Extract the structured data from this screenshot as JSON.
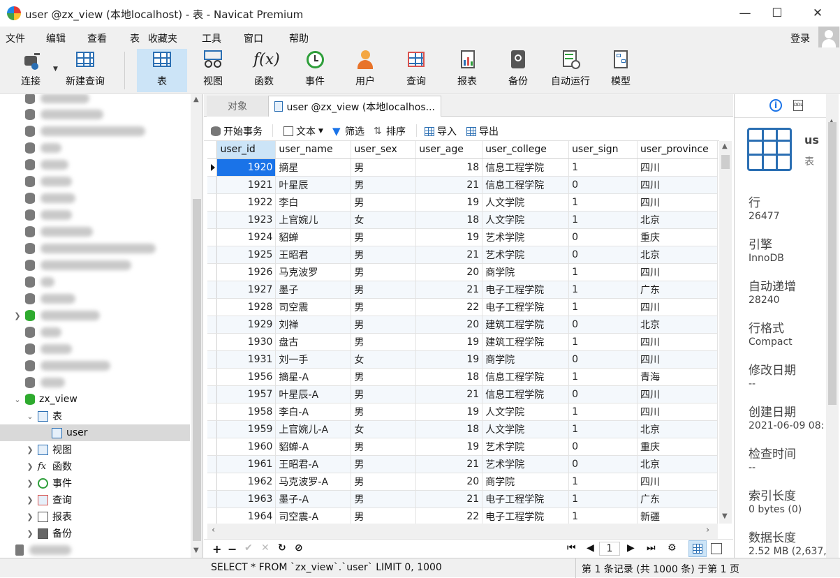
{
  "window": {
    "title": "user @zx_view (本地localhost) - 表 - Navicat Premium"
  },
  "menu": [
    "文件",
    "编辑",
    "查看",
    "表",
    "收藏夹",
    "工具",
    "窗口",
    "帮助"
  ],
  "login": "登录",
  "toolbar": {
    "connect": "连接",
    "new_query": "新建查询",
    "table": "表",
    "view": "视图",
    "function": "函数",
    "event": "事件",
    "user": "用户",
    "query": "查询",
    "report": "报表",
    "backup": "备份",
    "automation": "自动运行",
    "model": "模型"
  },
  "sidebar": {
    "db": "zx_view",
    "tables_group": "表",
    "table_user": "user",
    "view": "视图",
    "function": "函数",
    "event": "事件",
    "query": "查询",
    "report": "报表",
    "backup": "备份"
  },
  "tabs": {
    "objects": "对象",
    "active": "user @zx_view (本地localhos..."
  },
  "subtoolbar": {
    "begin_tx": "开始事务",
    "text": "文本",
    "filter": "筛选",
    "sort": "排序",
    "import": "导入",
    "export": "导出"
  },
  "columns": [
    "user_id",
    "user_name",
    "user_sex",
    "user_age",
    "user_college",
    "user_sign",
    "user_province"
  ],
  "rows": [
    [
      "1920",
      "摘星",
      "男",
      "18",
      "信息工程学院",
      "1",
      "四川"
    ],
    [
      "1921",
      "叶星辰",
      "男",
      "21",
      "信息工程学院",
      "0",
      "四川"
    ],
    [
      "1922",
      "李白",
      "男",
      "19",
      "人文学院",
      "1",
      "四川"
    ],
    [
      "1923",
      "上官婉儿",
      "女",
      "18",
      "人文学院",
      "1",
      "北京"
    ],
    [
      "1924",
      "貂蝉",
      "男",
      "19",
      "艺术学院",
      "0",
      "重庆"
    ],
    [
      "1925",
      "王昭君",
      "男",
      "21",
      "艺术学院",
      "0",
      "北京"
    ],
    [
      "1926",
      "马克波罗",
      "男",
      "20",
      "商学院",
      "1",
      "四川"
    ],
    [
      "1927",
      "墨子",
      "男",
      "21",
      "电子工程学院",
      "1",
      "广东"
    ],
    [
      "1928",
      "司空震",
      "男",
      "22",
      "电子工程学院",
      "1",
      "四川"
    ],
    [
      "1929",
      "刘禅",
      "男",
      "20",
      "建筑工程学院",
      "0",
      "北京"
    ],
    [
      "1930",
      "盘古",
      "男",
      "19",
      "建筑工程学院",
      "1",
      "四川"
    ],
    [
      "1931",
      "刘一手",
      "女",
      "19",
      "商学院",
      "0",
      "四川"
    ],
    [
      "1956",
      "摘星-A",
      "男",
      "18",
      "信息工程学院",
      "1",
      "青海"
    ],
    [
      "1957",
      "叶星辰-A",
      "男",
      "21",
      "信息工程学院",
      "0",
      "四川"
    ],
    [
      "1958",
      "李白-A",
      "男",
      "19",
      "人文学院",
      "1",
      "四川"
    ],
    [
      "1959",
      "上官婉儿-A",
      "女",
      "18",
      "人文学院",
      "1",
      "北京"
    ],
    [
      "1960",
      "貂蝉-A",
      "男",
      "19",
      "艺术学院",
      "0",
      "重庆"
    ],
    [
      "1961",
      "王昭君-A",
      "男",
      "21",
      "艺术学院",
      "0",
      "北京"
    ],
    [
      "1962",
      "马克波罗-A",
      "男",
      "20",
      "商学院",
      "1",
      "四川"
    ],
    [
      "1963",
      "墨子-A",
      "男",
      "21",
      "电子工程学院",
      "1",
      "广东"
    ],
    [
      "1964",
      "司空震-A",
      "男",
      "22",
      "电子工程学院",
      "1",
      "新疆"
    ]
  ],
  "navbar": {
    "page": "1"
  },
  "status": {
    "sql": "SELECT * FROM `zx_view`.`user` LIMIT 0, 1000",
    "records": "第 1 条记录 (共 1000 条) 于第 1 页"
  },
  "info_panel": {
    "name": "us",
    "type": "表",
    "rows_label": "行",
    "rows_value": "26477",
    "engine_label": "引擎",
    "engine_value": "InnoDB",
    "auto_inc_label": "自动递增",
    "auto_inc_value": "28240",
    "row_format_label": "行格式",
    "row_format_value": "Compact",
    "modified_label": "修改日期",
    "modified_value": "--",
    "created_label": "创建日期",
    "created_value": "2021-06-09 08:",
    "checked_label": "检查时间",
    "checked_value": "--",
    "index_len_label": "索引长度",
    "index_len_value": "0 bytes (0)",
    "data_len_label": "数据长度",
    "data_len_value": "2.52 MB (2,637,"
  },
  "colors": {
    "accent": "#1a73e8",
    "selection": "#cce4f7",
    "green_db": "#2eaa2e"
  }
}
